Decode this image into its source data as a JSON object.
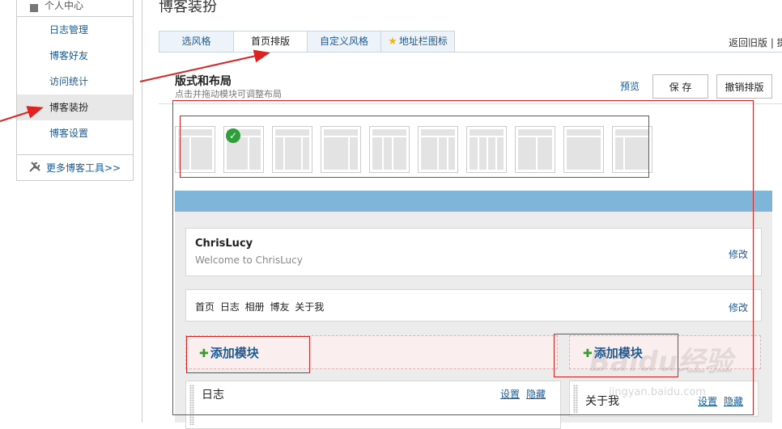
{
  "sidebar": {
    "header": "个人中心",
    "items": [
      {
        "label": "日志管理"
      },
      {
        "label": "博客好友"
      },
      {
        "label": "访问统计"
      },
      {
        "label": "博客装扮",
        "active": true
      },
      {
        "label": "博客设置"
      }
    ],
    "tools_label": "更多博客工具>>"
  },
  "page_title": "博客装扮",
  "tabs": [
    {
      "label": "选风格"
    },
    {
      "label": "首页排版",
      "active": true
    },
    {
      "label": "自定义风格"
    },
    {
      "label": "地址栏图标",
      "icon": "star-icon"
    }
  ],
  "top_right": "返回旧版 | 提",
  "layout": {
    "title": "版式和布局",
    "subtitle": "点击并拖动模块可调整布局",
    "preview": "预览",
    "save": "保 存",
    "cancel": "撤销排版",
    "thumbnails_selected_index": 1,
    "thumbnail_count": 10
  },
  "canvas": {
    "header_box": {
      "name": "ChrisLucy",
      "welcome": "Welcome to ChrisLucy",
      "edit": "修改"
    },
    "nav_box": {
      "text": "首页 日志 相册 博友 关于我",
      "edit": "修改"
    },
    "add_module_left": "添加模块",
    "add_module_right": "添加模块",
    "module_left": {
      "title": "日志",
      "settings": "设置",
      "hide": "隐藏"
    },
    "module_right": {
      "title": "关于我",
      "settings": "设置",
      "hide": "隐藏"
    }
  },
  "watermark": {
    "logo": "Baidu经验",
    "url": "jingyan.baidu.com"
  },
  "colors": {
    "link": "#1a5a96",
    "blue_bar": "#7fb5d9",
    "highlight": "#dd2222",
    "add_plus": "#3a9c2e"
  }
}
